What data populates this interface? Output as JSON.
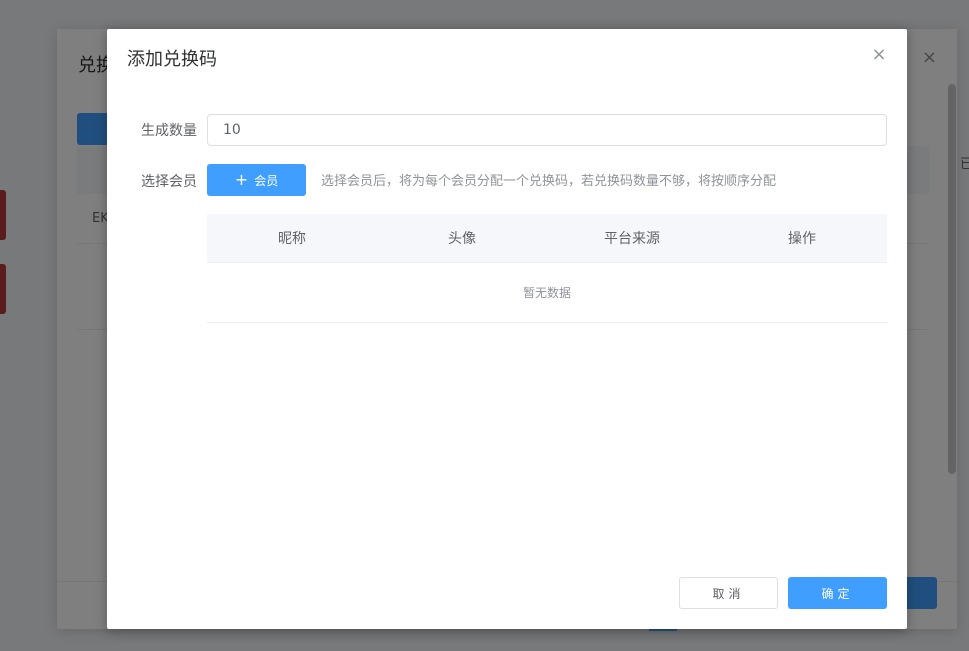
{
  "background_dialog": {
    "title_fragment": "兑换",
    "row_text_fragment": "EK",
    "right_text_fragment": "已"
  },
  "modal": {
    "title": "添加兑换码",
    "close_glyph": "×",
    "quantity_label": "生成数量",
    "quantity_value": "10",
    "member_label": "选择会员",
    "member_button_plus": "+",
    "member_button_label": "会员",
    "hint": "选择会员后，将为每个会员分配一个兑换码，若兑换码数量不够，将按顺序分配",
    "table": {
      "columns": [
        "昵称",
        "头像",
        "平台来源",
        "操作"
      ],
      "empty_text": "暂无数据"
    },
    "cancel_label": "取消",
    "confirm_label": "确定"
  },
  "colors": {
    "primary": "#409eff",
    "overlay": "rgba(0,0,0,0.5)"
  },
  "icons": [
    "close-icon",
    "plus-icon"
  ]
}
